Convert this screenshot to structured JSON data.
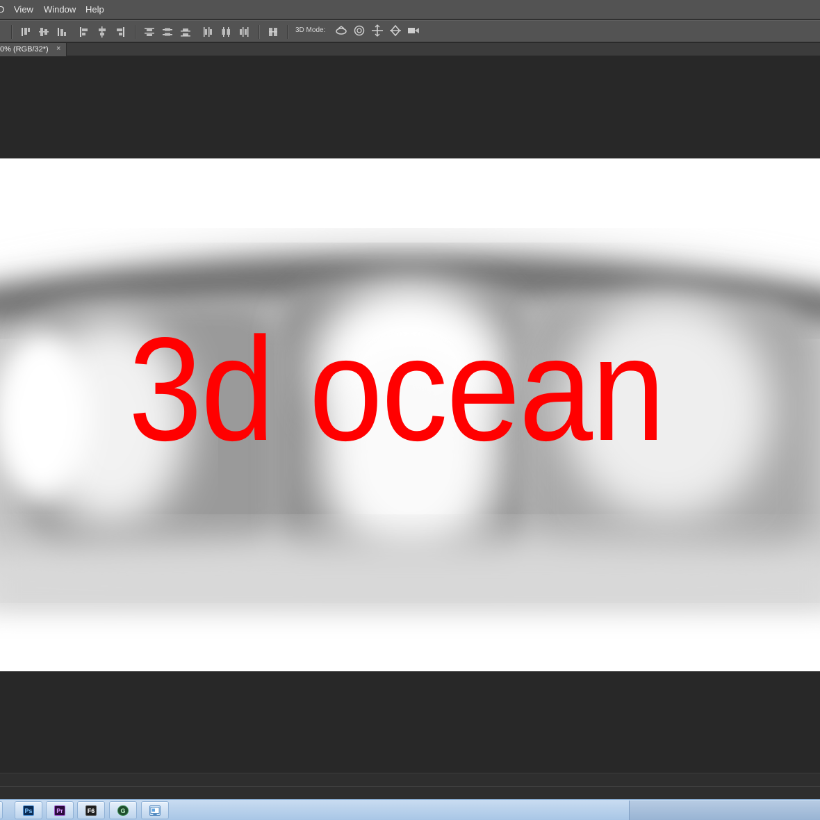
{
  "menu": {
    "items": [
      "D",
      "View",
      "Window",
      "Help"
    ]
  },
  "options_bar": {
    "mode_label": "3D Mode:"
  },
  "document_tab": {
    "title": "0% (RGB/32*)",
    "close_glyph": "×"
  },
  "canvas": {
    "text": "3d ocean",
    "text_color": "#ff0000"
  },
  "taskbar": {
    "apps": [
      {
        "name": "photoshop",
        "label": "Ps"
      },
      {
        "name": "premiere",
        "label": "Pr"
      },
      {
        "name": "f6",
        "label": "F6"
      },
      {
        "name": "green-app",
        "label": "G"
      },
      {
        "name": "window-app",
        "label": ""
      }
    ]
  }
}
